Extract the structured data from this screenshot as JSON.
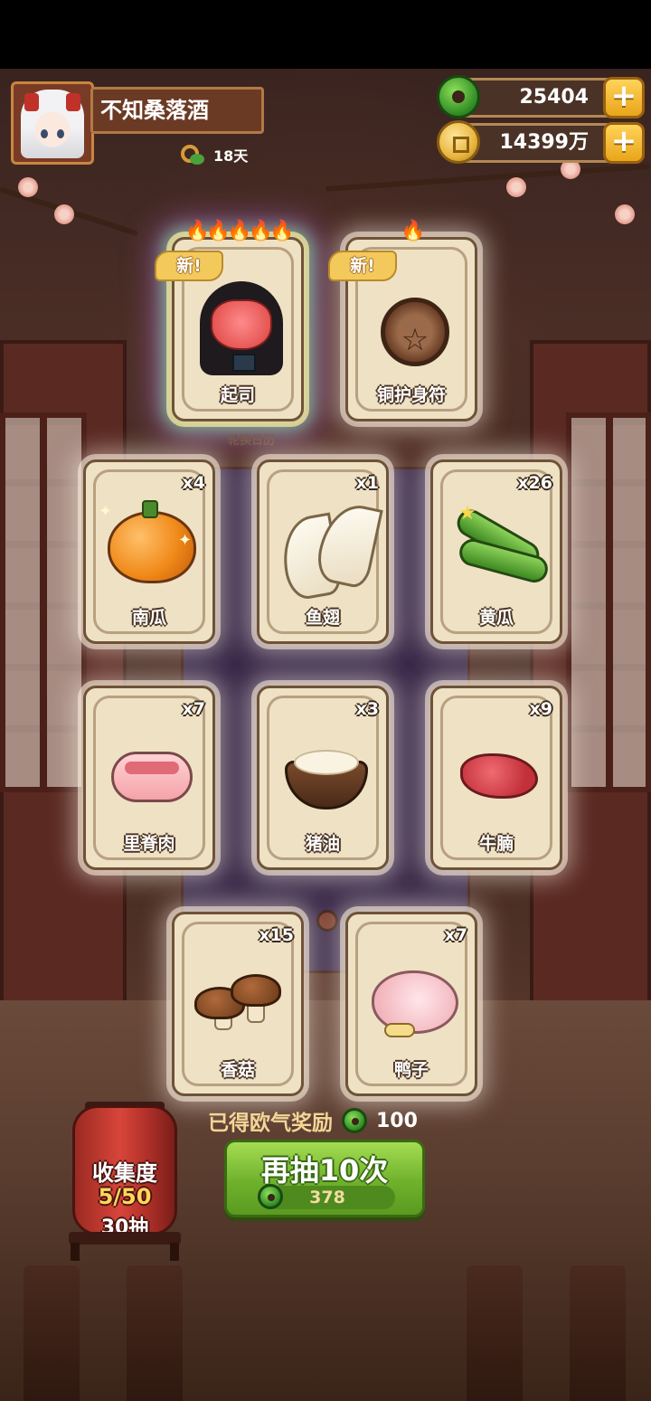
{
  "player": {
    "name": "不知桑落酒",
    "days": "18天"
  },
  "currency": {
    "jade": "25404",
    "coins": "14399万",
    "jade_icon": "jade-icon",
    "coin_icon": "coin-icon",
    "add_icon": "plus-icon"
  },
  "calendar_label": "轮换日历",
  "cards": [
    {
      "label": "起司",
      "tag": "新!",
      "flames": 5,
      "rarity": "legendary",
      "icon": "nun-character-icon"
    },
    {
      "label": "铜护身符",
      "tag": "新!",
      "flames": 1,
      "rarity": "rare",
      "icon": "pentagram-amulet-icon"
    },
    {
      "label": "南瓜",
      "count": "x4",
      "icon": "pumpkin-icon"
    },
    {
      "label": "鱼翅",
      "count": "x1",
      "icon": "shark-fin-icon"
    },
    {
      "label": "黄瓜",
      "count": "x26",
      "icon": "cucumber-icon"
    },
    {
      "label": "里脊肉",
      "count": "x7",
      "icon": "tenderloin-icon"
    },
    {
      "label": "猪油",
      "count": "x3",
      "icon": "lard-bowl-icon"
    },
    {
      "label": "牛腩",
      "count": "x9",
      "icon": "beef-brisket-icon"
    },
    {
      "label": "香菇",
      "count": "x15",
      "icon": "shiitake-icon"
    },
    {
      "label": "鸭子",
      "count": "x7",
      "icon": "duck-icon"
    }
  ],
  "reward": {
    "label": "已得欧气奖励",
    "value": "100"
  },
  "draw_button": {
    "label": "再抽10次",
    "cost": "378"
  },
  "collection": {
    "title": "收集度",
    "progress": "5/50",
    "draws": "30抽"
  },
  "colors": {
    "accent_green": "#6fb12c",
    "gold": "#e9a51a",
    "card_bg": "#efe1c4",
    "lantern_red": "#d8453a"
  }
}
